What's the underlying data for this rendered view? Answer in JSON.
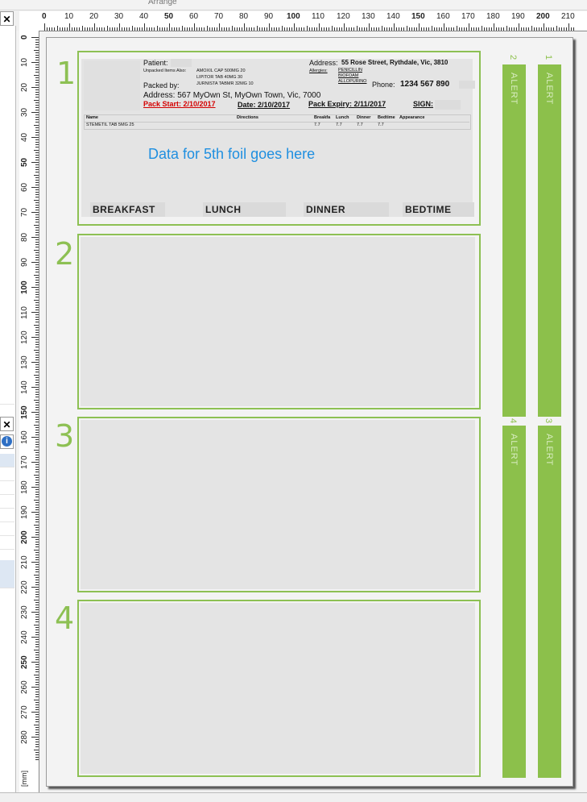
{
  "toolbar": {
    "group_label": "Arrange"
  },
  "ruler": {
    "unit": "[mm]",
    "h_labels": [
      "0",
      "10",
      "20",
      "30",
      "40",
      "50",
      "60",
      "70",
      "80",
      "90",
      "100",
      "110",
      "120",
      "130",
      "140",
      "150",
      "160",
      "170",
      "180",
      "190",
      "200",
      "210"
    ],
    "v_labels": [
      "0",
      "10",
      "20",
      "30",
      "40",
      "50",
      "60",
      "70",
      "80",
      "90",
      "100",
      "110",
      "120",
      "130",
      "140",
      "150",
      "160",
      "170",
      "180",
      "190",
      "200",
      "210",
      "220",
      "230",
      "240",
      "250",
      "260",
      "270",
      "280"
    ]
  },
  "foils": [
    {
      "number": "1"
    },
    {
      "number": "2"
    },
    {
      "number": "3"
    },
    {
      "number": "4"
    }
  ],
  "alerts": [
    {
      "number": "1",
      "label": "ALERT"
    },
    {
      "number": "2",
      "label": "ALERT"
    },
    {
      "number": "3",
      "label": "ALERT"
    },
    {
      "number": "4",
      "label": "ALERT"
    }
  ],
  "foil1": {
    "patient_label": "Patient:",
    "unpacked_label": "Unpacked Items Also:",
    "unpacked_items": [
      "AMOXIL CAP 500MG 20",
      "LIPITOR TAB 40MG 30",
      "JURNISTA TABMR 32MG 10"
    ],
    "packed_by_label": "Packed by:",
    "address_label": "Address:",
    "pharmacy_address": "55 Rose Street, Rythdale, Vic, 3810",
    "allergies_label": "Allergies:",
    "allergies": [
      "PENICILLIN",
      "BIOFOAM",
      "ALLOPURINO"
    ],
    "phone_label": "Phone:",
    "phone": "1234 567 890",
    "patient_address": "Address: 567 MyOwn St, MyOwn Town, Vic, 7000",
    "pack_start": "Pack Start: 2/10/2017",
    "date": "Date: 2/10/2017",
    "pack_expiry": "Pack Expiry: 2/11/2017",
    "sign": "SIGN:",
    "table_headers": [
      "Name",
      "Directions",
      "Breakfa",
      "Lunch",
      "Dinner",
      "Bedtime",
      "Appearance"
    ],
    "table_rows": [
      [
        "STEMETIL TAB 5MG 25",
        "",
        "7.7",
        "7.7",
        "7.7",
        "7.7",
        ""
      ]
    ],
    "placeholder": "Data for 5th foil goes here",
    "meals": [
      "BREAKFAST",
      "LUNCH",
      "DINNER",
      "BEDTIME"
    ]
  },
  "colors": {
    "accent": "#8cc04b",
    "placeholder": "#1f8fe0",
    "warning": "#d40000"
  }
}
